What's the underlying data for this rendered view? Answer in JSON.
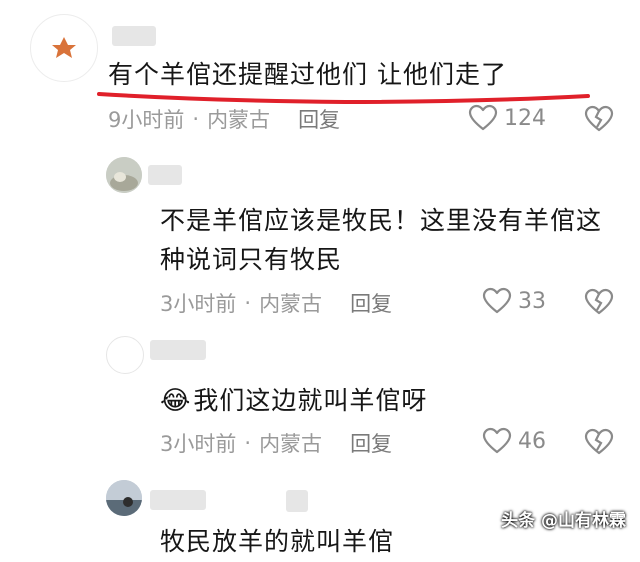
{
  "comments": [
    {
      "text": "有个羊倌还提醒过他们 让他们走了",
      "time": "9小时前",
      "location": "内蒙古",
      "reply_label": "回复",
      "likes": "124"
    },
    {
      "text_line1": "不是羊倌应该是牧民！这里没有羊倌这",
      "text_line2": "种说词只有牧民",
      "time": "3小时前",
      "location": "内蒙古",
      "reply_label": "回复",
      "likes": "33"
    },
    {
      "emoji": "😂",
      "text": "我们这边就叫羊倌呀",
      "time": "3小时前",
      "location": "内蒙古",
      "reply_label": "回复",
      "likes": "46"
    },
    {
      "text": "牧民放羊的就叫羊倌"
    }
  ],
  "separator": "·",
  "watermark": "头条 @山有林霖",
  "colors": {
    "underline": "#e0202a",
    "text": "#161616",
    "meta": "#9a9a9a"
  }
}
